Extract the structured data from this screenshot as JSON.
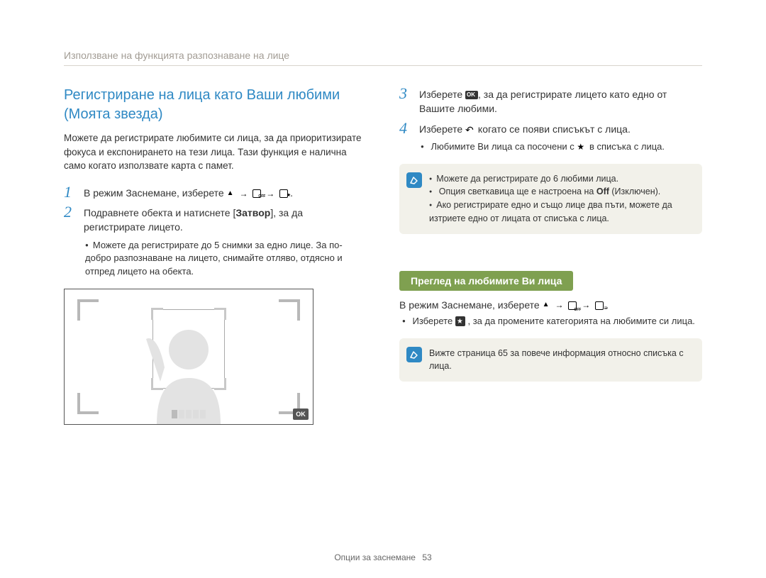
{
  "header": "Използване на функцията разпознаване на лице",
  "left": {
    "title": "Регистриране на лица като Ваши любими (Моята звезда)",
    "intro": "Можете да регистрирате любимите си лица, за да приоритизирате фокуса и експонирането на тези лица. Тази функция е налична само когато използвате карта с памет.",
    "step1_prefix": "В режим Заснемане, изберете ",
    "step2_prefix": "Подравнете обекта и натиснете [",
    "step2_bold": "Затвор",
    "step2_suffix": "], за да регистрирате лицето.",
    "step2_bullet": "Можете да регистрирате до 5 снимки за едно лице. За по-добро разпознаване на лицето, снимайте отляво, отдясно и отпред лицето на обекта.",
    "ok_label": "OK"
  },
  "right": {
    "step3_prefix": "Изберете ",
    "step3_suffix": ", за да регистрирате лицето като едно от Вашите любими.",
    "step4_prefix": "Изберете ",
    "step4_suffix": " когато се появи списъкът с лица.",
    "step4_bullet_a": "Любимите Ви лица са посочени с ",
    "step4_bullet_b": " в списъка с лица.",
    "note1_items": [
      "Можете да регистрирате до 6 любими лица.",
      "Опция светкавица ще е настроена на Off (Изключен).",
      "Ако регистрирате едно и също лице два пъти, можете да изтриете едно от лицата от списъка с лица."
    ],
    "note1_off_bold": "Off",
    "subhead": "Преглед на любимите Ви лица",
    "review_prefix": "В режим Заснемане, изберете ",
    "review_bullet_a": "Изберете ",
    "review_bullet_b": ", за да промените категорията на любимите си лица.",
    "note2": "Вижте страница 65 за повече информация относно списъка с лица."
  },
  "footer": {
    "label": "Опции за заснемане",
    "page": "53"
  }
}
